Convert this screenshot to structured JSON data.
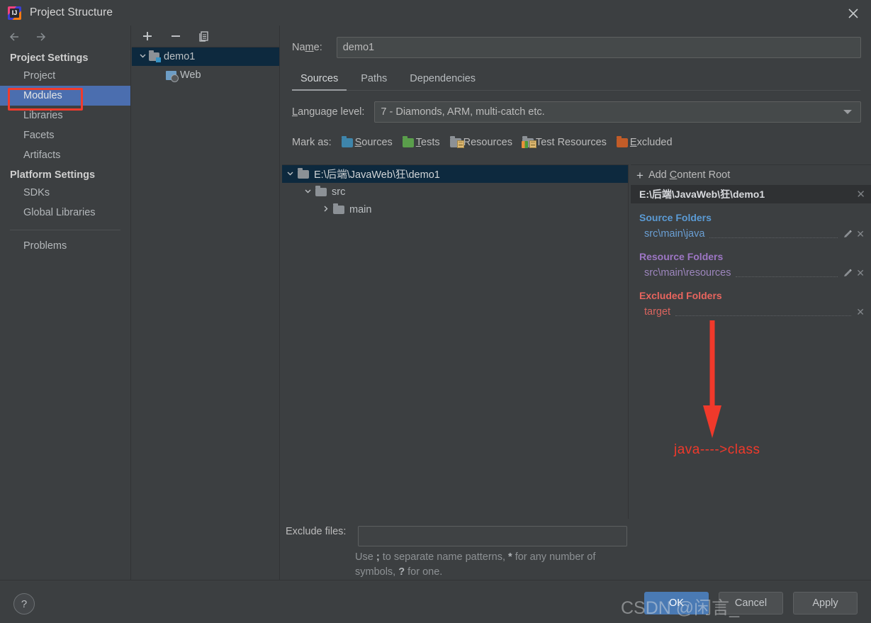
{
  "window": {
    "title": "Project Structure",
    "logo_icon": "intellij-idea-icon",
    "close_icon": "close-icon"
  },
  "sidebar": {
    "back_icon": "arrow-left-icon",
    "forward_icon": "arrow-right-icon",
    "sections": [
      {
        "heading": "Project Settings",
        "items": [
          {
            "label": "Project",
            "selected": false
          },
          {
            "label": "Modules",
            "selected": true
          },
          {
            "label": "Libraries",
            "selected": false
          },
          {
            "label": "Facets",
            "selected": false
          },
          {
            "label": "Artifacts",
            "selected": false
          }
        ]
      },
      {
        "heading": "Platform Settings",
        "items": [
          {
            "label": "SDKs",
            "selected": false
          },
          {
            "label": "Global Libraries",
            "selected": false
          }
        ]
      }
    ],
    "problems_label": "Problems",
    "selection_color": "#4b6eaf",
    "annotation_color": "#f03b2d"
  },
  "module_list": {
    "toolbar": {
      "add_icon": "plus-icon",
      "remove_icon": "minus-icon",
      "copy_icon": "copy-icon"
    },
    "items": [
      {
        "label": "demo1",
        "icon": "module-folder-icon",
        "selected": true,
        "expanded": true,
        "twisty": "⌄"
      },
      {
        "label": "Web",
        "icon": "web-facet-icon",
        "selected": false
      }
    ]
  },
  "main": {
    "name_label": "Name:",
    "name_label_prefix": "Na",
    "name_label_accel": "m",
    "name_label_suffix": "e:",
    "name_value": "demo1",
    "tabs": [
      {
        "label": "Sources",
        "active": true
      },
      {
        "label": "Paths",
        "active": false
      },
      {
        "label": "Dependencies",
        "active": false
      }
    ],
    "language_level_label_accel": "L",
    "language_level_label_rest": "anguage level:",
    "language_level_value": "7 - Diamonds, ARM, multi-catch etc.",
    "dropdown_icon": "chevron-down-icon",
    "mark_as_label": "Mark as:",
    "mark_as_options": [
      {
        "label": "Sources",
        "accel": "S",
        "rest": "ources",
        "icon": "sources-folder-icon",
        "color": "#3e85ab"
      },
      {
        "label": "Tests",
        "accel": "T",
        "rest": "ests",
        "icon": "tests-folder-icon",
        "color": "#5a9e4b"
      },
      {
        "label": "Resources",
        "accel": "",
        "rest": "Resources",
        "icon": "resources-folder-icon",
        "color": "#8c9196"
      },
      {
        "label": "Test Resources",
        "accel": "",
        "rest": "Test Resources",
        "icon": "test-resources-folder-icon",
        "color": "#8c9196"
      },
      {
        "label": "Excluded",
        "accel": "E",
        "rest": "xcluded",
        "icon": "excluded-folder-icon",
        "color": "#c25c28"
      }
    ],
    "tree": [
      {
        "label": "E:\\后端\\JavaWeb\\狂\\demo1",
        "depth": 0,
        "twisty": "⌄",
        "selected": true
      },
      {
        "label": "src",
        "depth": 1,
        "twisty": "⌄",
        "selected": false
      },
      {
        "label": "main",
        "depth": 2,
        "twisty": "›",
        "selected": false
      }
    ],
    "exclude_files_label": "Exclude files:",
    "exclude_files_value": "",
    "exclude_hint_line1_a": "Use ",
    "exclude_hint_sep": ";",
    "exclude_hint_line1_b": " to separate name patterns, ",
    "exclude_hint_star": "*",
    "exclude_hint_line1_c": " for any number of",
    "exclude_hint_line2_a": "symbols, ",
    "exclude_hint_q": "?",
    "exclude_hint_line2_b": " for one."
  },
  "detail": {
    "add_content_root_prefix": "Add ",
    "add_content_root_accel": "C",
    "add_content_root_rest": "ontent Root",
    "add_icon": "plus-icon",
    "root_path": "E:\\后端\\JavaWeb\\狂\\demo1",
    "root_close_icon": "close-icon",
    "groups": [
      {
        "title": "Source Folders",
        "color": "#5b9bd5",
        "entries": [
          {
            "path": "src\\main\\java",
            "has_edit": true,
            "edit_icon": "pencil-icon",
            "remove_icon": "close-icon"
          }
        ]
      },
      {
        "title": "Resource Folders",
        "color": "#9d76c4",
        "entries": [
          {
            "path": "src\\main\\resources",
            "has_edit": true,
            "edit_icon": "pencil-icon",
            "remove_icon": "close-icon"
          }
        ]
      },
      {
        "title": "Excluded Folders",
        "color": "#e8655e",
        "entries": [
          {
            "path": "target",
            "has_edit": false,
            "edit_icon": "",
            "remove_icon": "close-icon"
          }
        ]
      }
    ]
  },
  "annotation": {
    "arrow_icon": "red-down-arrow",
    "arrow_color": "#f0392b",
    "text": "java---->class"
  },
  "footer": {
    "help_label": "?",
    "help_icon": "help-icon",
    "buttons": [
      {
        "label": "OK",
        "primary": true
      },
      {
        "label": "Cancel",
        "primary": false
      },
      {
        "label": "Apply",
        "primary": false
      }
    ],
    "ok_color": "#4a7ab4"
  },
  "watermark": {
    "text": "CSDN @闲言_"
  }
}
